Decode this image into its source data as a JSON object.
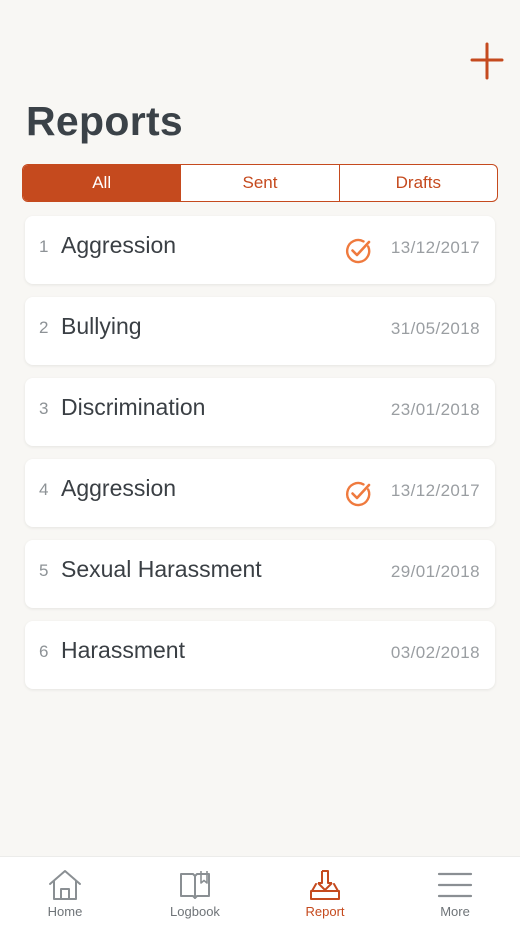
{
  "header": {
    "title": "Reports",
    "add_icon": "plus-icon"
  },
  "filter": {
    "segments": [
      {
        "label": "All",
        "active": true
      },
      {
        "label": "Sent",
        "active": false
      },
      {
        "label": "Drafts",
        "active": false
      }
    ]
  },
  "reports": [
    {
      "index": "1",
      "title": "Aggression",
      "date": "13/12/2017",
      "sent": true
    },
    {
      "index": "2",
      "title": "Bullying",
      "date": "31/05/2018",
      "sent": false
    },
    {
      "index": "3",
      "title": "Discrimination",
      "date": "23/01/2018",
      "sent": false
    },
    {
      "index": "4",
      "title": "Aggression",
      "date": "13/12/2017",
      "sent": true
    },
    {
      "index": "5",
      "title": "Sexual Harassment",
      "date": "29/01/2018",
      "sent": false
    },
    {
      "index": "6",
      "title": "Harassment",
      "date": "03/02/2018",
      "sent": false
    }
  ],
  "tabbar": {
    "tabs": [
      {
        "label": "Home",
        "icon": "home-icon",
        "active": false
      },
      {
        "label": "Logbook",
        "icon": "book-icon",
        "active": false
      },
      {
        "label": "Report",
        "icon": "report-icon",
        "active": true
      },
      {
        "label": "More",
        "icon": "menu-icon",
        "active": false
      }
    ]
  },
  "colors": {
    "accent": "#c54a1e",
    "check": "#ef7a3e",
    "background": "#f8f7f4",
    "text": "#3a3f44",
    "muted": "#9a9ea2"
  }
}
